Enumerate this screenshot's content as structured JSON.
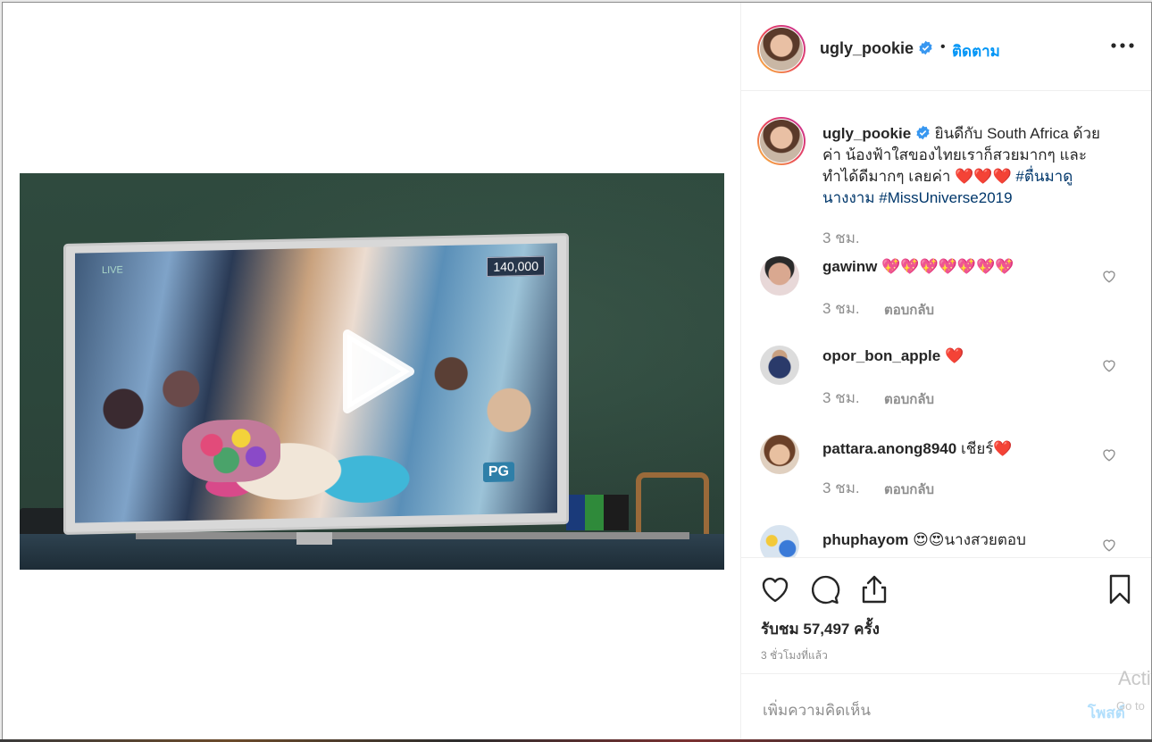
{
  "post": {
    "username": "ugly_pookie",
    "follow_label": "ติดตาม",
    "dot": "•",
    "caption": {
      "text": "ยินดีกับ South Africa ด้วยค่า น้องฟ้าใสของไทยเราก็สวยมากๆ และทำได้ดีมากๆ เลยค่า ❤️❤️❤️",
      "tag1": "#ตื่นมาดูนางงาม",
      "tag2": "#MissUniverse2019",
      "time": "3 ชม."
    },
    "video": {
      "counter": "140,000",
      "live_label": "LIVE",
      "rating": "PG"
    }
  },
  "comments": [
    {
      "user": "gawinw",
      "text": "💖💖💖💖💖💖💖",
      "time": "3 ชม.",
      "reply": "ตอบกลับ"
    },
    {
      "user": "opor_bon_apple",
      "text": "❤️",
      "time": "3 ชม.",
      "reply": "ตอบกลับ"
    },
    {
      "user": "pattara.anong8940",
      "text": "เชียร์❤️",
      "time": "3 ชม.",
      "reply": "ตอบกลับ"
    },
    {
      "user": "phuphayom",
      "text": "😍😍นางสวยตอบ"
    }
  ],
  "actions": {
    "views": "รับชม 57,497 ครั้ง",
    "posted_ago": "3 ชั่วโมงที่แล้ว"
  },
  "add_comment": {
    "placeholder": "เพิ่มความคิดเห็น",
    "post_label": "โพสต์"
  },
  "os_watermark": {
    "line1": "Acti",
    "line2": "Go to"
  },
  "colors": {
    "link": "#0095f6",
    "tag": "#00376b",
    "muted": "#8e8e8e",
    "heart": "#e0245e"
  }
}
